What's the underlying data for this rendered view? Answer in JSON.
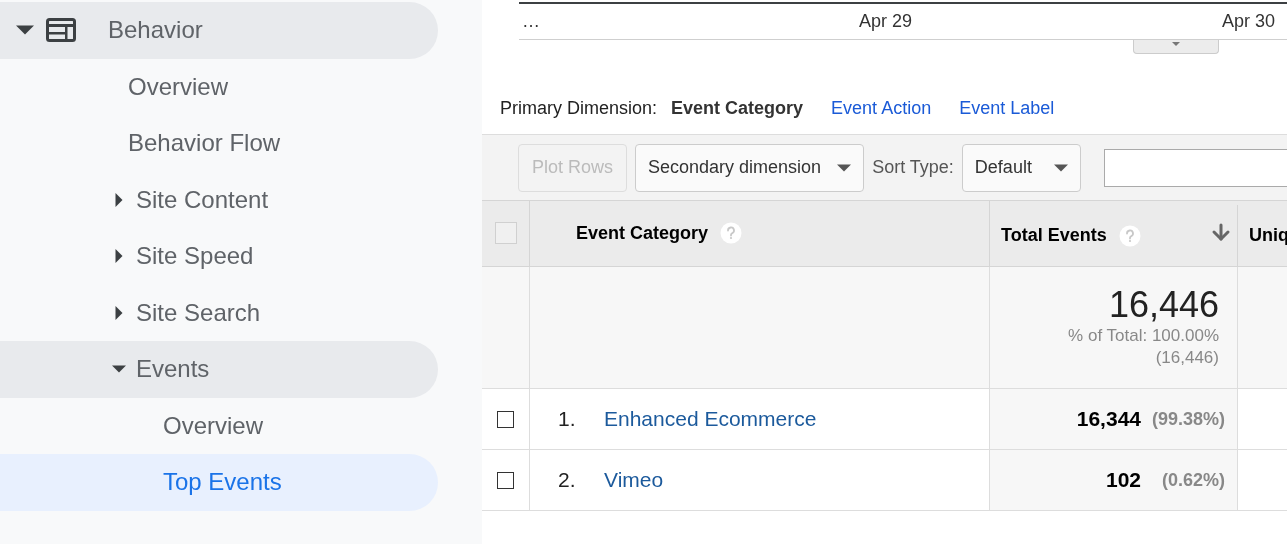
{
  "sidebar": {
    "items": [
      {
        "label": "Behavior",
        "expanded": true,
        "selected": false,
        "children": [
          {
            "label": "Overview",
            "selected": false
          },
          {
            "label": "Behavior Flow",
            "selected": false
          },
          {
            "label": "Site Content",
            "expanded": false,
            "selected": false
          },
          {
            "label": "Site Speed",
            "expanded": false,
            "selected": false
          },
          {
            "label": "Site Search",
            "expanded": false,
            "selected": false
          },
          {
            "label": "Events",
            "expanded": true,
            "selected": false,
            "children": [
              {
                "label": "Overview",
                "selected": false
              },
              {
                "label": "Top Events",
                "selected": true
              }
            ]
          }
        ]
      }
    ]
  },
  "chart_axis": {
    "labels": [
      "…",
      "Apr 29",
      "Apr 30"
    ]
  },
  "primary_dimension": {
    "label": "Primary Dimension:",
    "options": [
      {
        "label": "Event Category",
        "selected": true
      },
      {
        "label": "Event Action",
        "selected": false
      },
      {
        "label": "Event Label",
        "selected": false
      }
    ]
  },
  "toolbar": {
    "plot_rows": {
      "label": "Plot Rows",
      "disabled": true
    },
    "secondary_dimension": "Secondary dimension",
    "sort_type_label": "Sort Type:",
    "sort_type": "Default"
  },
  "table": {
    "select_all": {
      "checked": false
    },
    "columns": [
      {
        "label": "Event Category",
        "help": true
      },
      {
        "label": "Total Events",
        "help": true,
        "sorted": true
      },
      {
        "label": "Uniq"
      }
    ],
    "totals": {
      "value": "16,446",
      "percent": "% of Total: 100.00%",
      "absolute": "(16,446)"
    },
    "rows": [
      {
        "index": "1.",
        "name": "Enhanced Ecommerce",
        "value": "16,344",
        "percent": "(99.38%)",
        "checked": false
      },
      {
        "index": "2.",
        "name": "Vimeo",
        "value": "102",
        "percent": "(0.62%)",
        "checked": false
      }
    ]
  }
}
